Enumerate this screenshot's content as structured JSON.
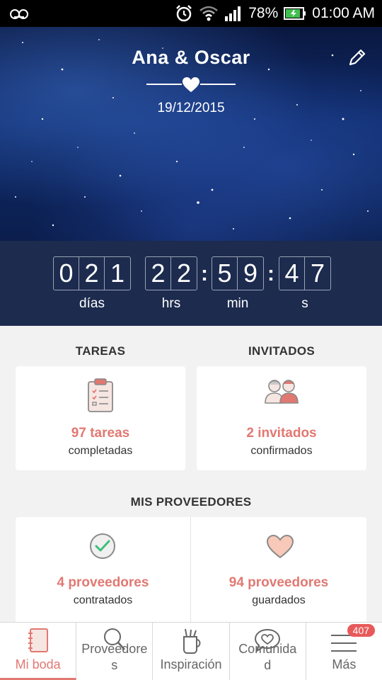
{
  "status_bar": {
    "battery": "78%",
    "time": "01:00 AM"
  },
  "header": {
    "couple_name": "Ana & Oscar",
    "wedding_date": "19/12/2015"
  },
  "countdown": {
    "days": [
      "0",
      "2",
      "1"
    ],
    "hours": [
      "2",
      "2"
    ],
    "minutes": [
      "5",
      "9"
    ],
    "seconds": [
      "4",
      "7"
    ],
    "labels": {
      "days": "días",
      "hours": "hrs",
      "minutes": "min",
      "seconds": "s"
    }
  },
  "tareas": {
    "title": "TAREAS",
    "count": "97 tareas",
    "subtitle": "completadas",
    "icon": "clipboard-checklist-icon"
  },
  "invitados": {
    "title": "INVITADOS",
    "count": "2 invitados",
    "subtitle": "confirmados",
    "icon": "guests-couple-icon"
  },
  "proveedores": {
    "title": "MIS PROVEEDORES",
    "contratados": {
      "count": "4 proveedores",
      "subtitle": "contratados",
      "icon": "check-circle-icon"
    },
    "guardados": {
      "count": "94 proveedores",
      "subtitle": "guardados",
      "icon": "heart-icon"
    }
  },
  "bottom_nav": {
    "items": [
      {
        "label": "Mi boda",
        "icon": "notebook-icon"
      },
      {
        "label": "Proveedore\ns",
        "icon": "search-icon"
      },
      {
        "label": "Inspiración",
        "icon": "cup-icon"
      },
      {
        "label": "Comunida\nd",
        "icon": "chat-heart-icon"
      },
      {
        "label": "Más",
        "icon": "menu-icon"
      }
    ],
    "badge": "407"
  },
  "colors": {
    "accent": "#e27872",
    "countdown_bg": "#1c2b4e",
    "hero_dark": "#0b1e4d"
  }
}
